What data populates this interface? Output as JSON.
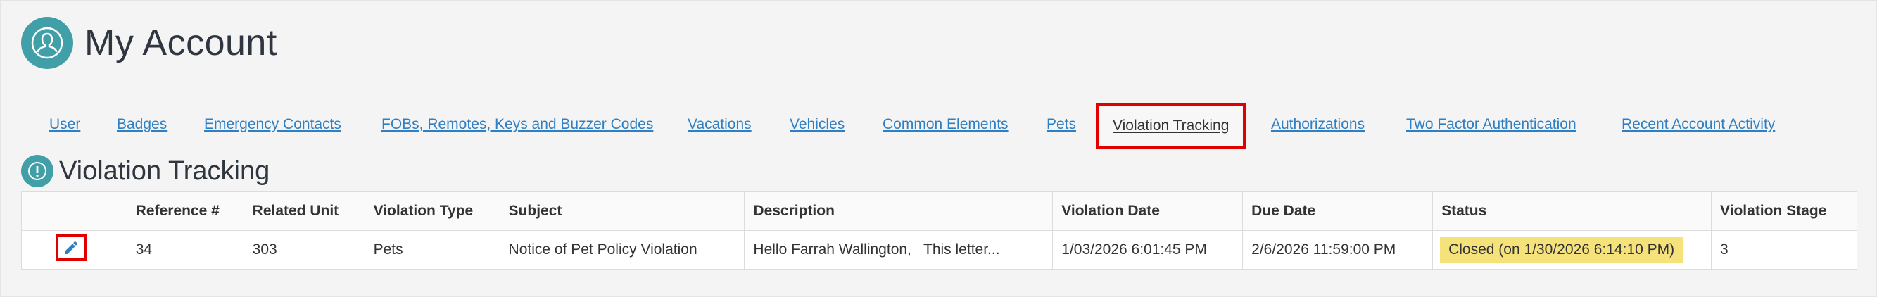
{
  "page": {
    "title": "My Account",
    "avatar_icon": "user-avatar-icon"
  },
  "tabs": [
    {
      "label": "User"
    },
    {
      "label": "Badges"
    },
    {
      "label": "Emergency Contacts"
    },
    {
      "label": "FOBs, Remotes, Keys and Buzzer Codes"
    },
    {
      "label": "Vacations"
    },
    {
      "label": "Vehicles"
    },
    {
      "label": "Common Elements"
    },
    {
      "label": "Pets"
    },
    {
      "label": "Violation Tracking",
      "active": true
    },
    {
      "label": "Authorizations"
    },
    {
      "label": "Two Factor Authentication"
    },
    {
      "label": "Recent Account Activity"
    }
  ],
  "section": {
    "title": "Violation Tracking",
    "icon": "exclamation-icon"
  },
  "table": {
    "headers": [
      "",
      "Reference #",
      "Related Unit",
      "Violation Type",
      "Subject",
      "Description",
      "Violation Date",
      "Due Date",
      "Status",
      "Violation Stage"
    ],
    "rows": [
      {
        "reference": "34",
        "unit": "303",
        "type": "Pets",
        "subject": "Notice of Pet Policy Violation",
        "description": "Hello Farrah Wallington,   This letter...",
        "violation_date": "1/03/2026 6:01:45 PM",
        "due_date": "2/6/2026 11:59:00 PM",
        "status": "Closed (on 1/30/2026 6:14:10 PM)",
        "stage": "3"
      }
    ]
  },
  "colors": {
    "accent": "#41a0a7",
    "link": "#2f7fc2",
    "highlight": "#e00000",
    "status_bg": "#f5e27a"
  }
}
